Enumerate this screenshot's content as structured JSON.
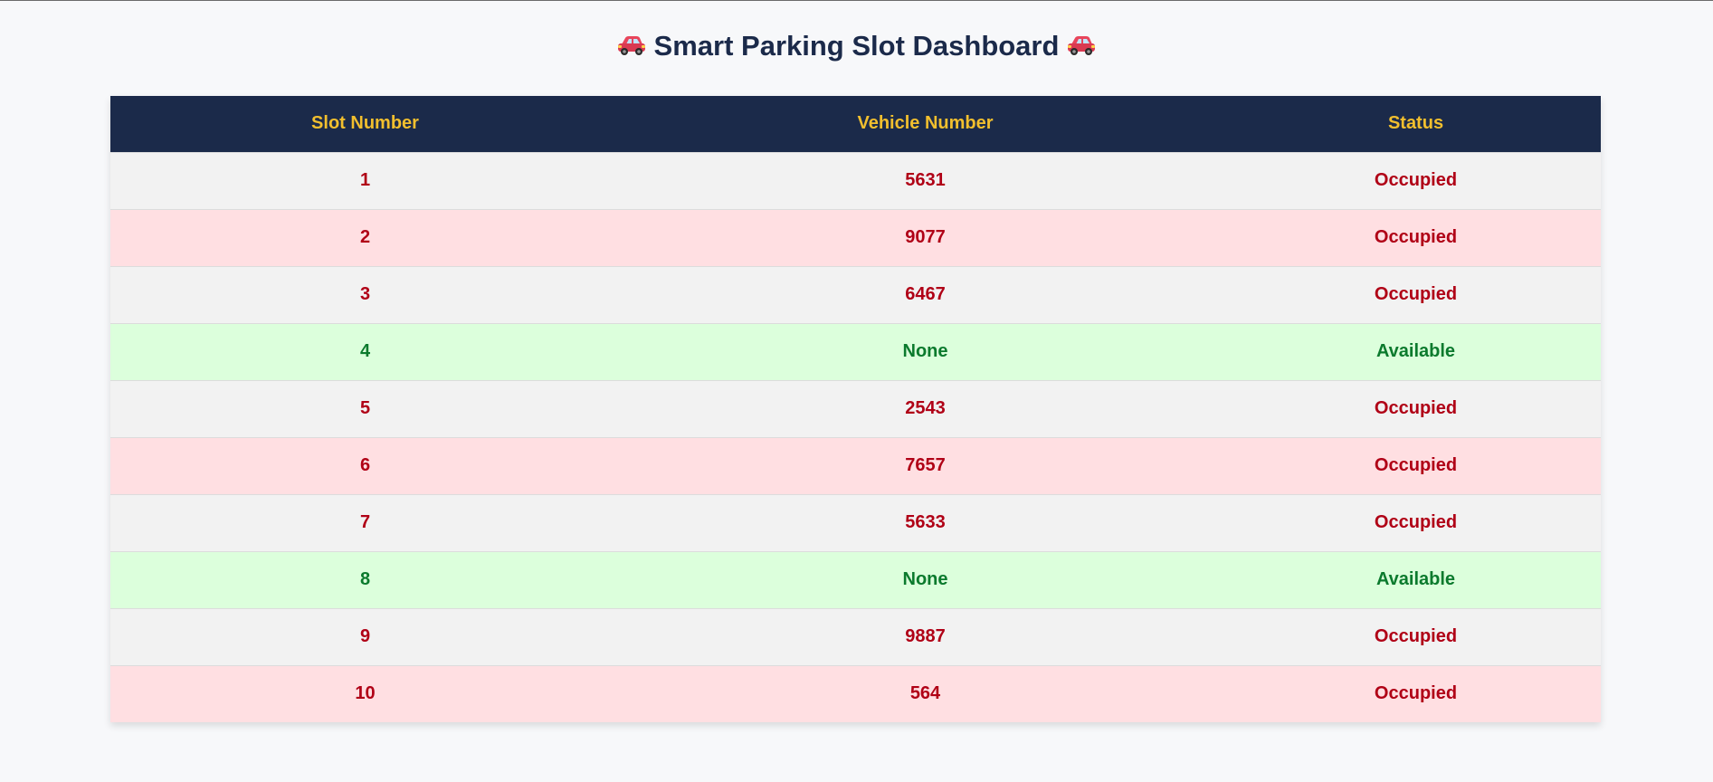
{
  "page": {
    "title": "Smart Parking Slot Dashboard",
    "title_icon": "car-icon"
  },
  "colors": {
    "header_bg": "#1b2a4a",
    "header_text": "#f2bf2e",
    "occupied_text": "#b00016",
    "available_text": "#0b7a2d",
    "occupied_row_bg": "#ffdfe2",
    "available_row_bg": "#dcffdc",
    "neutral_row_bg": "#f2f2f2"
  },
  "table": {
    "headers": [
      "Slot Number",
      "Vehicle Number",
      "Status"
    ],
    "rows": [
      {
        "slot": "1",
        "vehicle": "5631",
        "status": "Occupied",
        "bg": "gray"
      },
      {
        "slot": "2",
        "vehicle": "9077",
        "status": "Occupied",
        "bg": "red"
      },
      {
        "slot": "3",
        "vehicle": "6467",
        "status": "Occupied",
        "bg": "gray"
      },
      {
        "slot": "4",
        "vehicle": "None",
        "status": "Available",
        "bg": "green"
      },
      {
        "slot": "5",
        "vehicle": "2543",
        "status": "Occupied",
        "bg": "gray"
      },
      {
        "slot": "6",
        "vehicle": "7657",
        "status": "Occupied",
        "bg": "red"
      },
      {
        "slot": "7",
        "vehicle": "5633",
        "status": "Occupied",
        "bg": "gray"
      },
      {
        "slot": "8",
        "vehicle": "None",
        "status": "Available",
        "bg": "green"
      },
      {
        "slot": "9",
        "vehicle": "9887",
        "status": "Occupied",
        "bg": "gray"
      },
      {
        "slot": "10",
        "vehicle": "564",
        "status": "Occupied",
        "bg": "red"
      }
    ]
  }
}
